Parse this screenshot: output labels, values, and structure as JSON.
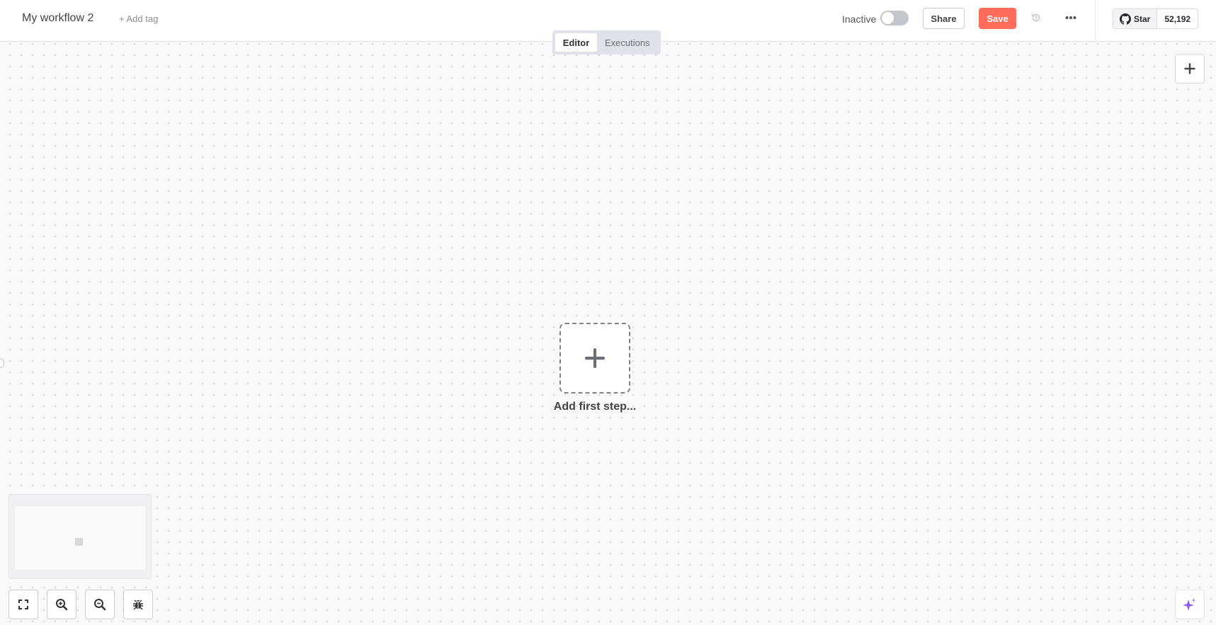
{
  "header": {
    "workflow_title": "My workflow 2",
    "add_tag_label": "+ Add tag",
    "active_status_label": "Inactive",
    "share_label": "Share",
    "save_label": "Save",
    "github_star_label": "Star",
    "github_star_count": "52,192"
  },
  "mode_tabs": [
    {
      "label": "Editor",
      "active": true
    },
    {
      "label": "Executions",
      "active": false
    }
  ],
  "canvas": {
    "add_first_step_label": "Add first step..."
  },
  "colors": {
    "save_button": "#ff6d5a",
    "ai_assistant": "#8b5cf6"
  },
  "icons": {
    "history": "history-icon",
    "more": "ellipsis-icon",
    "github": "github-icon",
    "canvas_add": "plus-icon",
    "fit_view": "fullscreen-icon",
    "zoom_in": "zoom-in-icon",
    "zoom_out": "zoom-out-icon",
    "debug": "bug-icon",
    "ai_assistant": "sparkle-icon"
  }
}
